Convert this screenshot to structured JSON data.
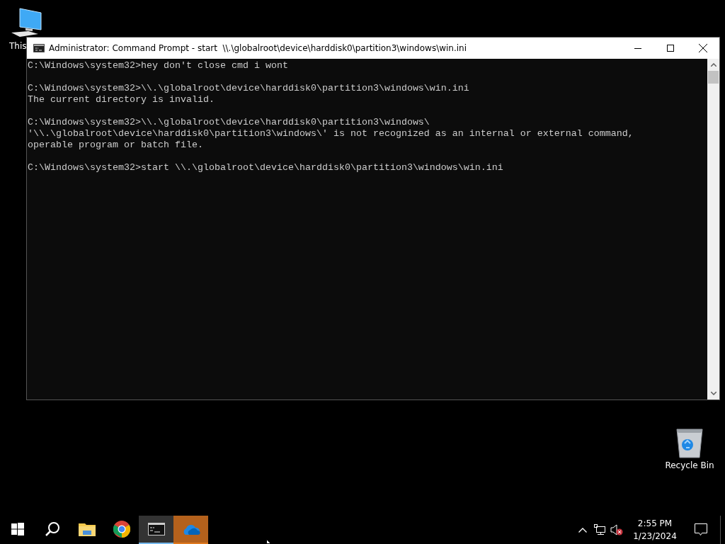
{
  "desktop_icons": [
    {
      "kind": "computer",
      "label": "This"
    },
    {
      "kind": "recycle",
      "label": "Recycle Bin"
    }
  ],
  "window": {
    "title": "Administrator: Command Prompt - start  \\\\.\\globalroot\\device\\harddisk0\\partition3\\windows\\win.ini",
    "console_blocks": [
      [
        "C:\\Windows\\system32>hey don't close cmd i wont"
      ],
      [
        "C:\\Windows\\system32>\\\\.\\globalroot\\device\\harddisk0\\partition3\\windows\\win.ini",
        "The current directory is invalid."
      ],
      [
        "C:\\Windows\\system32>\\\\.\\globalroot\\device\\harddisk0\\partition3\\windows\\",
        "'\\\\.\\globalroot\\device\\harddisk0\\partition3\\windows\\' is not recognized as an internal or external command,",
        "operable program or batch file."
      ],
      [
        "C:\\Windows\\system32>start \\\\.\\globalroot\\device\\harddisk0\\partition3\\windows\\win.ini"
      ]
    ]
  },
  "taskbar": {
    "items": [
      {
        "kind": "start",
        "selected": false,
        "attention": false
      },
      {
        "kind": "search",
        "selected": false,
        "attention": false
      },
      {
        "kind": "folder",
        "selected": false,
        "attention": false
      },
      {
        "kind": "browser",
        "selected": false,
        "attention": false
      },
      {
        "kind": "console",
        "selected": true,
        "attention": false
      },
      {
        "kind": "cloud",
        "selected": false,
        "attention": true
      }
    ],
    "tray": {
      "muted": true,
      "time": "2:55 PM",
      "date": "1/23/2024"
    }
  }
}
